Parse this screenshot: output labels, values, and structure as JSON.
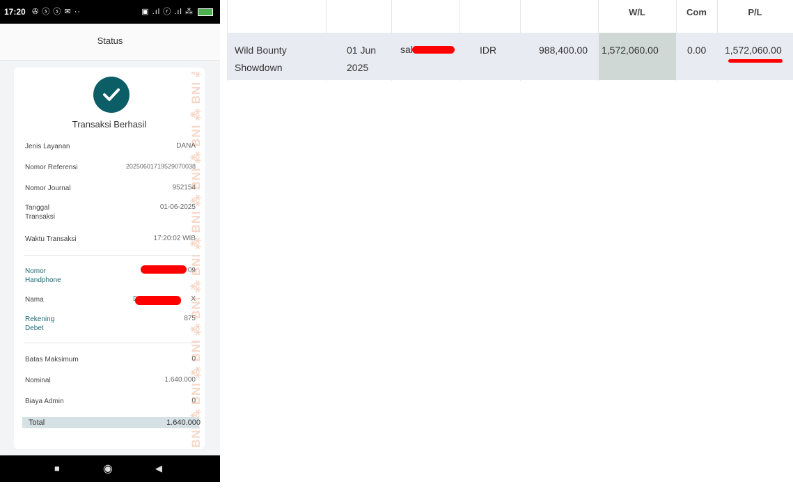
{
  "status_bar": {
    "time": "17:20",
    "left_icons": "✇ ⓢ ⓢ ✉ ··",
    "right_icons": "▣ .ıl ⓡ .ıl ⁂"
  },
  "header": {
    "title": "Status"
  },
  "receipt": {
    "watermark": "BNI ⁂ BNI ⁂ BNI ⁂ BNI ⁂ BNI ⁂ BNI ⁂ BNI ⁂ BNI ⁂ BNI ⁂ BNI ⁂",
    "title": "Transaksi Berhasil",
    "rows": [
      {
        "label": "Jenis Layanan",
        "value": "DANA"
      },
      {
        "label": "Nomor Referensi",
        "value": "20250601719529070038"
      },
      {
        "label": "Nomor Journal",
        "value": "952154"
      },
      {
        "label": "Tanggal Transaksi",
        "value": "01-06-2025"
      },
      {
        "label": "Waktu Transaksi",
        "value": "17:20:02 WIB"
      }
    ],
    "recipient": [
      {
        "label": "Nomor Handphone",
        "value": "09"
      },
      {
        "label": "Nama",
        "value": "X",
        "prefix": "D"
      },
      {
        "label": "Rekening Debet",
        "value": "875"
      }
    ],
    "amounts": [
      {
        "label": "Batas Maksimum",
        "value": "0"
      },
      {
        "label": "Nominal",
        "value": "1.640.000"
      },
      {
        "label": "Biaya Admin",
        "value": "0"
      }
    ],
    "total": {
      "label": "Total",
      "value": "1.640.000"
    }
  },
  "table": {
    "headers": {
      "wl": "W/L",
      "com": "Com",
      "pl": "P/L"
    },
    "row": {
      "game": "Wild Bounty Showdown",
      "date": "01 Jun 2025",
      "user": "sal",
      "currency": "IDR",
      "bet": "988,400.00",
      "wl": "1,572,060.00",
      "com": "0.00",
      "pl": "1,572,060.00"
    }
  },
  "colors": {
    "accent_teal": "#0b5d66",
    "redaction": "#ff0000",
    "total_bar": "#d5e1e4",
    "wl_highlight": "#cfd8d4"
  }
}
